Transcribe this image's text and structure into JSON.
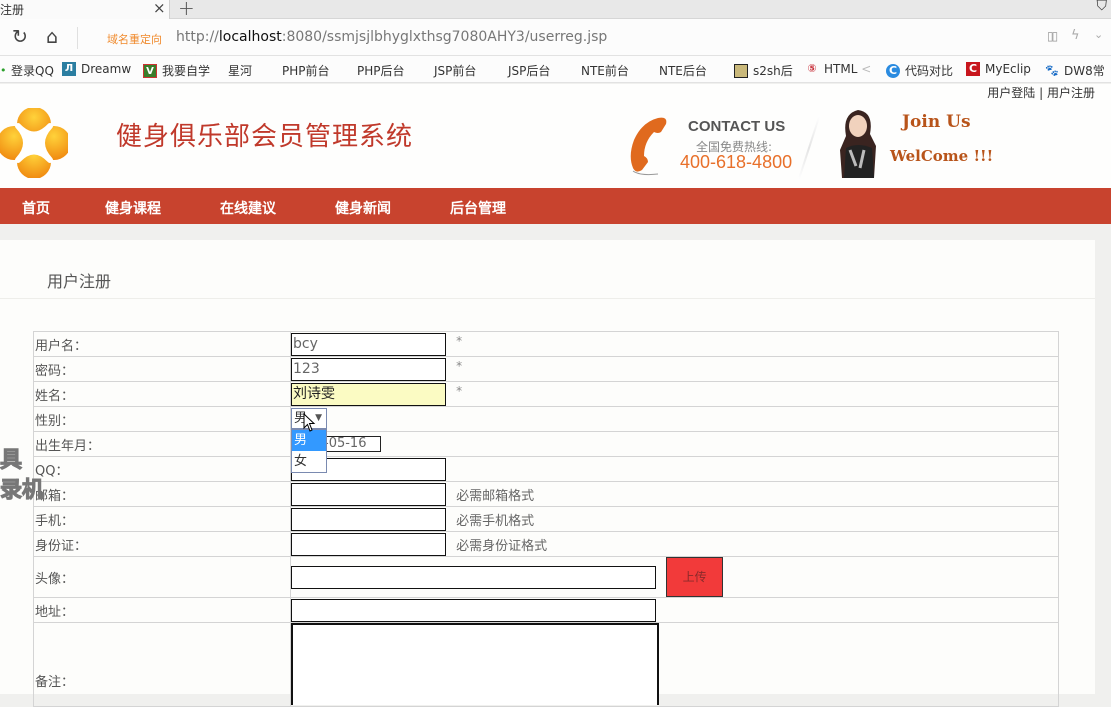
{
  "browser": {
    "tab_title": "注册",
    "url_prefix": "http://",
    "url_host": "localhost",
    "url_rest": ":8080/ssmjsjlbhyglxthsg7080AHY3/userreg.jsp",
    "redirect_label": "域名重定向",
    "bookmarks": [
      {
        "label": "登录QQ",
        "icon": "qq-icon"
      },
      {
        "label": "Dreamw",
        "icon": "dreamweaver-icon"
      },
      {
        "label": "我要自学",
        "icon": "vv-icon"
      },
      {
        "label": "星河",
        "icon": "page-icon"
      },
      {
        "label": "PHP前台",
        "icon": "page-icon"
      },
      {
        "label": "PHP后台",
        "icon": "page-icon"
      },
      {
        "label": "JSP前台",
        "icon": "page-icon"
      },
      {
        "label": "JSP后台",
        "icon": "page-icon"
      },
      {
        "label": "NTE前台",
        "icon": "page-icon"
      },
      {
        "label": "NTE后台",
        "icon": "page-icon"
      },
      {
        "label": "s2sh后",
        "icon": "s2sh-icon"
      },
      {
        "label": "HTML",
        "icon": "html5-icon"
      },
      {
        "label": "代码对比",
        "icon": "compare-icon"
      },
      {
        "label": "MyEclip",
        "icon": "myeclipse-icon"
      },
      {
        "label": "DW8常",
        "icon": "baidu-icon"
      }
    ]
  },
  "header": {
    "login_link": "用户登陆",
    "separator": "|",
    "register_link": "用户注册",
    "site_title": "健身俱乐部会员管理系统",
    "contact_title": "CONTACT US",
    "contact_sub": "全国免费热线:",
    "contact_phone": "400-618-4800",
    "join_text": "Join Us",
    "welcome_text": "WelCome !!!"
  },
  "nav": {
    "items": [
      "首页",
      "健身课程",
      "在线建议",
      "健身新闻",
      "后台管理"
    ]
  },
  "form": {
    "title": "用户注册",
    "fields": {
      "username": {
        "label": "用户名：",
        "value": "bcy",
        "note": "*"
      },
      "password": {
        "label": "密码：",
        "value": "123",
        "note": "*"
      },
      "name": {
        "label": "姓名：",
        "value": "刘诗雯",
        "note": "*"
      },
      "gender": {
        "label": "性别：",
        "value": "男",
        "options": [
          "男",
          "女"
        ],
        "highlighted": "男"
      },
      "birth": {
        "label": "出生年月：",
        "value": "-05-16"
      },
      "qq": {
        "label": "QQ：",
        "value": ""
      },
      "email": {
        "label": "邮箱：",
        "value": "",
        "note": "必需邮箱格式"
      },
      "mobile": {
        "label": "手机：",
        "value": "",
        "note": "必需手机格式"
      },
      "idcard": {
        "label": "身份证：",
        "value": "",
        "note": "必需身份证格式"
      },
      "avatar": {
        "label": "头像：",
        "value": "",
        "button": "上传"
      },
      "address": {
        "label": "地址：",
        "value": ""
      },
      "remark": {
        "label": "备注：",
        "value": ""
      }
    }
  },
  "watermark": {
    "line1": "具",
    "line2": "录机"
  },
  "colors": {
    "nav_bg": "#c8432e",
    "title_red": "#c0392b",
    "upload_btn": "#f23a3a",
    "highlight_input": "#fbfbc3",
    "select_active": "#3399ff"
  }
}
